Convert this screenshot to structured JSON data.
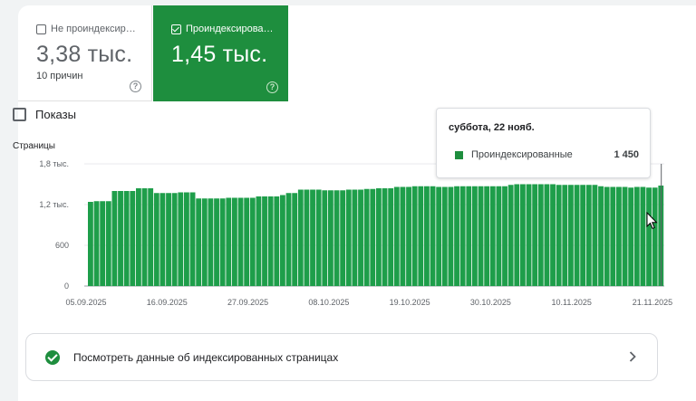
{
  "tiles": {
    "unindexed": {
      "label": "Не проиндексир…",
      "value": "3,38 тыс.",
      "sub": "10 причин",
      "help": "?"
    },
    "indexed": {
      "label": "Проиндексирова…",
      "value": "1,45 тыс.",
      "help": "?"
    }
  },
  "impressions_toggle": {
    "label": "Показы",
    "checked": false
  },
  "tooltip": {
    "date": "суббота, 22 нояб.",
    "series": "Проиндексированные",
    "value": "1 450"
  },
  "link_card": {
    "label": "Посмотреть данные об индексированных страницах"
  },
  "colors": {
    "accent": "#1e8e3e",
    "bar": "#1e9e4a"
  },
  "chart_data": {
    "type": "bar",
    "title": "",
    "ylabel": "Страницы",
    "xlabel": "",
    "ylim": [
      0,
      1800
    ],
    "yticks": [
      0,
      600,
      1200,
      1800
    ],
    "yticklabels": [
      "0",
      "600",
      "1,2 тыс.",
      "1,8 тыс."
    ],
    "xticklabels": [
      "05.09.2025",
      "16.09.2025",
      "27.09.2025",
      "08.10.2025",
      "19.10.2025",
      "30.10.2025",
      "10.11.2025",
      "21.11.2025"
    ],
    "series": [
      {
        "name": "Проиндексированные",
        "values": [
          1240,
          1250,
          1250,
          1250,
          1400,
          1400,
          1400,
          1400,
          1440,
          1440,
          1440,
          1370,
          1370,
          1370,
          1370,
          1380,
          1380,
          1380,
          1290,
          1290,
          1290,
          1290,
          1290,
          1300,
          1300,
          1300,
          1300,
          1300,
          1320,
          1320,
          1320,
          1320,
          1340,
          1370,
          1370,
          1420,
          1420,
          1420,
          1420,
          1410,
          1410,
          1410,
          1410,
          1420,
          1420,
          1420,
          1430,
          1430,
          1440,
          1440,
          1440,
          1460,
          1460,
          1460,
          1470,
          1470,
          1470,
          1470,
          1460,
          1460,
          1460,
          1470,
          1470,
          1470,
          1470,
          1470,
          1470,
          1470,
          1470,
          1470,
          1490,
          1500,
          1500,
          1500,
          1500,
          1500,
          1500,
          1500,
          1490,
          1490,
          1490,
          1490,
          1490,
          1490,
          1490,
          1470,
          1460,
          1460,
          1460,
          1460,
          1450,
          1460,
          1460,
          1450,
          1450,
          1480
        ]
      }
    ]
  }
}
